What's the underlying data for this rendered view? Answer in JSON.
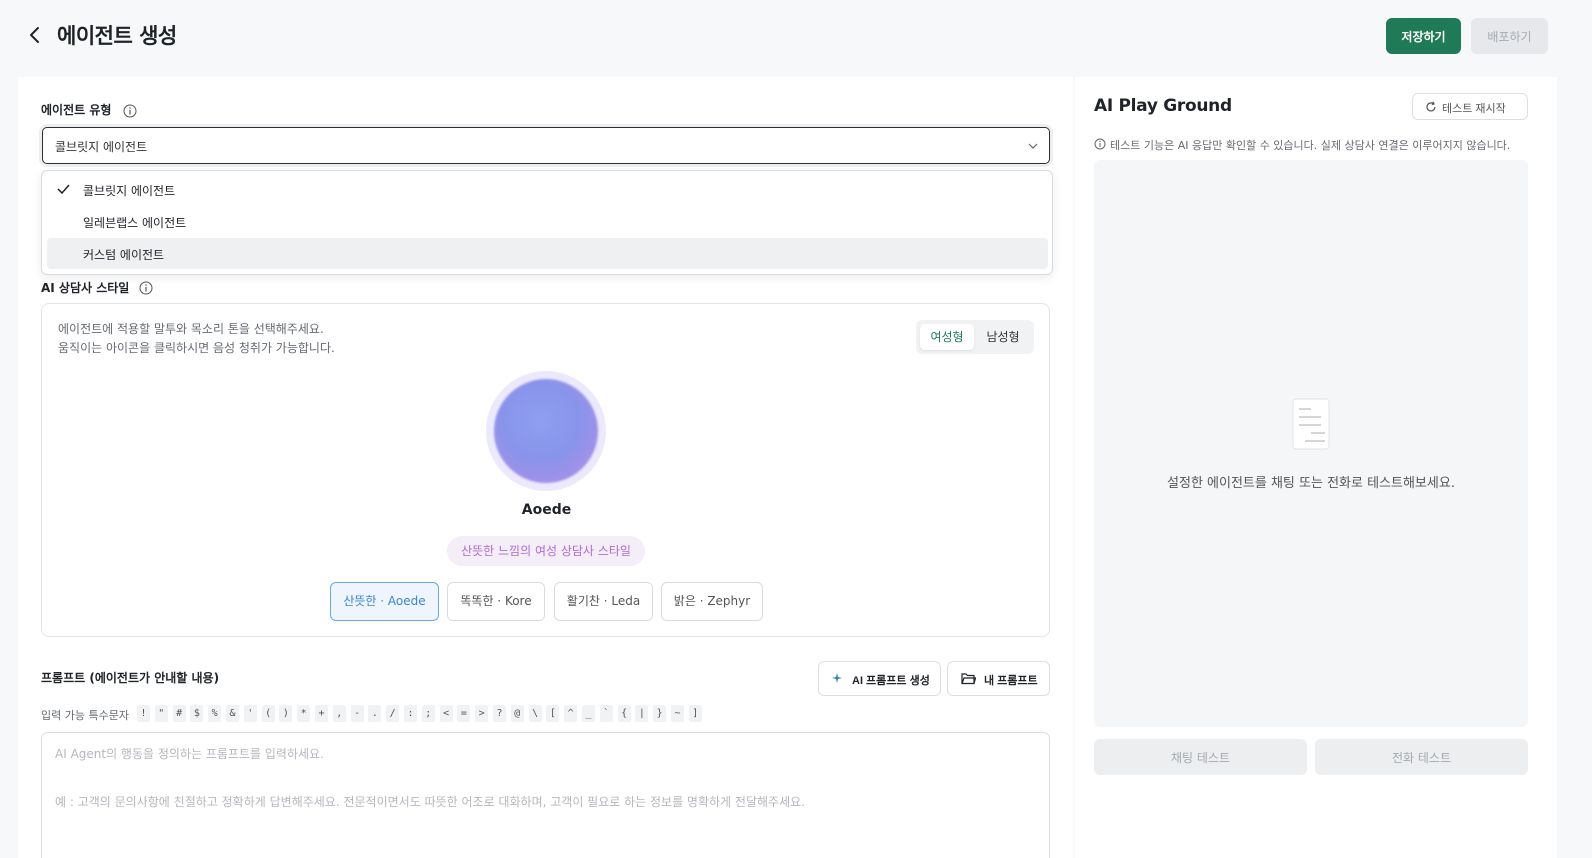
{
  "header": {
    "title": "에이전트 생성",
    "save_label": "저장하기",
    "deploy_label": "배포하기"
  },
  "agent_type": {
    "label": "에이전트 유형",
    "selected": "콜브릿지 에이전트",
    "options": [
      {
        "label": "콜브릿지 에이전트",
        "checked": true
      },
      {
        "label": "일레븐랩스 에이전트",
        "checked": false
      },
      {
        "label": "커스텀 에이전트",
        "checked": false,
        "hovered": true
      }
    ]
  },
  "counselor_style": {
    "label": "AI 상담사 스타일",
    "description_line1": "에이전트에 적용할 말투와 목소리 톤을 선택해주세요.",
    "description_line2": "움직이는 아이콘을 클릭하시면 음성 청취가 가능합니다.",
    "gender": {
      "female": "여성형",
      "male": "남성형",
      "selected": "여성형"
    },
    "voice_name": "Aoede",
    "voice_tag": "산뜻한 느낌의 여성 상담사 스타일",
    "voices": [
      {
        "label": "산뜻한 · Aoede",
        "selected": true
      },
      {
        "label": "똑똑한 · Kore",
        "selected": false
      },
      {
        "label": "활기찬 · Leda",
        "selected": false
      },
      {
        "label": "밝은 · Zephyr",
        "selected": false
      }
    ]
  },
  "prompt": {
    "label": "프롬프트 (에이전트가 안내할 내용)",
    "ai_generate_label": "AI 프롬프트 생성",
    "my_prompt_label": "내 프롬프트",
    "special_chars_label": "입력 가능 특수문자",
    "special_chars": [
      "!",
      "\"",
      "#",
      "$",
      "%",
      "&",
      "'",
      "(",
      ")",
      "*",
      "+",
      ",",
      "-",
      ".",
      "/",
      ":",
      ";",
      "<",
      "=",
      ">",
      "?",
      "@",
      "\\",
      "[",
      "^",
      "_",
      "`",
      "{",
      "|",
      "}",
      "~",
      "]"
    ],
    "placeholder": "AI Agent의 행동을 정의하는 프롬프트를 입력하세요.",
    "example": "예 : 고객의 문의사항에 친절하고 정확하게 답변해주세요. 전문적이면서도 따뜻한 어조로 대화하며, 고객이 필요로 하는 정보를 명확하게 전달해주세요."
  },
  "playground": {
    "title": "AI Play Ground",
    "restart_label": "테스트 재시작",
    "notice": "테스트 기능은 AI 응답만 확인할 수 있습니다. 실제 상담사 연결은 이루어지지 않습니다.",
    "empty_message": "설정한 에이전트를 채팅 또는 전화로 테스트해보세요.",
    "chat_test_label": "채팅 테스트",
    "call_test_label": "전화 테스트"
  },
  "colors": {
    "primary": "#1f7a57",
    "accent_blue": "#3a86d2",
    "tag_purple": "#b06bd0"
  }
}
